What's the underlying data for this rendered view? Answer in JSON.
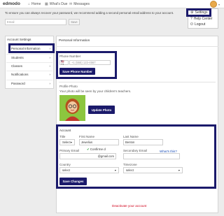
{
  "topbar": {
    "brand": "edmodo",
    "nav": [
      {
        "label": "Home",
        "icon": "home-icon"
      },
      {
        "label": "What's Due",
        "icon": "calendar-icon"
      },
      {
        "label": "Messages",
        "icon": "envelope-icon"
      }
    ]
  },
  "account_menu": {
    "items": [
      {
        "label": "Settings",
        "icon": "gear-icon"
      },
      {
        "label": "Help Center",
        "icon": "question-icon"
      },
      {
        "label": "Logout",
        "icon": "logout-icon"
      }
    ]
  },
  "notice": {
    "text": "To ensure you can always recover your password, we recommend adding a second personal email address to your account.",
    "email_placeholder": "Email",
    "save_label": "Save"
  },
  "sidebar": {
    "heading": "Account Settings",
    "items": [
      {
        "label": "Personal Information"
      },
      {
        "label": "Students"
      },
      {
        "label": "Classes"
      },
      {
        "label": "Notifications"
      },
      {
        "label": "Password"
      }
    ],
    "chevron": "›"
  },
  "panel": {
    "title": "Personal Information",
    "phone": {
      "label": "Phone Number",
      "country": "🇺🇸 +1",
      "placeholder": "+1 (555) 123-4567",
      "save_label": "Save Phone Number"
    },
    "photo": {
      "label": "Profile Photo",
      "hint": "Your photo will be seen by your children's teachers.",
      "update_label": "Update Photo"
    },
    "account": {
      "heading": "Account",
      "title_label": "Title",
      "title_value": "Select",
      "first_name_label": "First Name",
      "first_name_value": "Jewelius",
      "last_name_label": "Last Name",
      "last_name_value": "Benton",
      "primary_email_label": "Primary Email",
      "confirmed_text": "Confirme d",
      "primary_email_value": "@gmail.com",
      "secondary_email_label": "Secondary Email",
      "whats_this": "What's this?",
      "country_label": "Country",
      "country_value": "select",
      "timezone_label": "Timezone",
      "timezone_value": "select",
      "save_label": "Save Changes"
    },
    "deactivate_label": "Deactivate your account"
  }
}
